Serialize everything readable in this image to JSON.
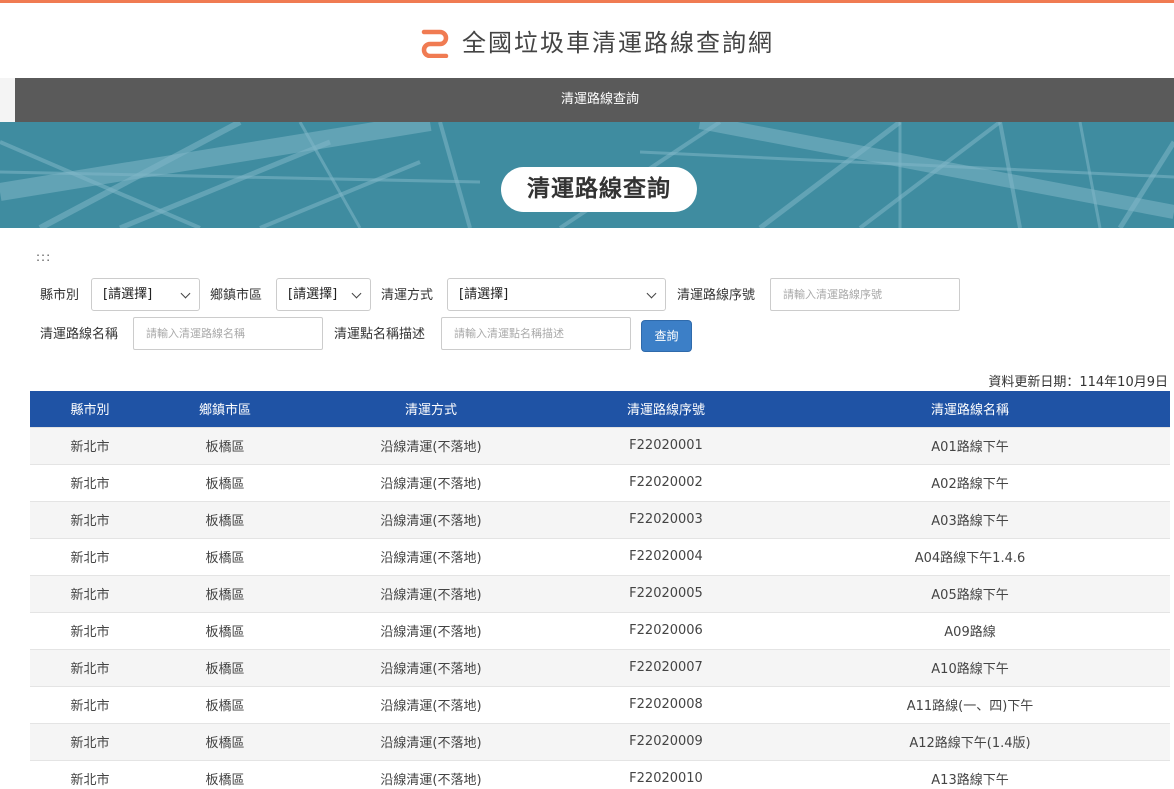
{
  "site": {
    "title": "全國垃圾車清運路線查詢網",
    "accent_color": "#f07b52",
    "logo_icon": "route-logo-icon"
  },
  "nav": {
    "items": [
      {
        "label": "清運路線查詢"
      }
    ]
  },
  "banner": {
    "title": "清運路線查詢"
  },
  "skip_link": ":::",
  "filters": {
    "county": {
      "label": "縣市別",
      "value": "[請選擇]"
    },
    "district": {
      "label": "鄉鎮市區",
      "value": "[請選擇]"
    },
    "method": {
      "label": "清運方式",
      "value": "[請選擇]"
    },
    "route_no": {
      "label": "清運路線序號",
      "placeholder": "請輸入清運路線序號"
    },
    "route_name": {
      "label": "清運路線名稱",
      "placeholder": "請輸入清運路線名稱"
    },
    "point_desc": {
      "label": "清運點名稱描述",
      "placeholder": "請輸入清運點名稱描述"
    },
    "search_label": "查詢"
  },
  "update_date": "資料更新日期：114年10月9日",
  "table": {
    "header_color": "#1f53a5",
    "columns": [
      "縣市別",
      "鄉鎮市區",
      "清運方式",
      "清運路線序號",
      "清運路線名稱"
    ],
    "rows": [
      [
        "新北市",
        "板橋區",
        "沿線清運(不落地)",
        "F22020001",
        "A01路線下午"
      ],
      [
        "新北市",
        "板橋區",
        "沿線清運(不落地)",
        "F22020002",
        "A02路線下午"
      ],
      [
        "新北市",
        "板橋區",
        "沿線清運(不落地)",
        "F22020003",
        "A03路線下午"
      ],
      [
        "新北市",
        "板橋區",
        "沿線清運(不落地)",
        "F22020004",
        "A04路線下午1.4.6"
      ],
      [
        "新北市",
        "板橋區",
        "沿線清運(不落地)",
        "F22020005",
        "A05路線下午"
      ],
      [
        "新北市",
        "板橋區",
        "沿線清運(不落地)",
        "F22020006",
        "A09路線"
      ],
      [
        "新北市",
        "板橋區",
        "沿線清運(不落地)",
        "F22020007",
        "A10路線下午"
      ],
      [
        "新北市",
        "板橋區",
        "沿線清運(不落地)",
        "F22020008",
        "A11路線(一、四)下午"
      ],
      [
        "新北市",
        "板橋區",
        "沿線清運(不落地)",
        "F22020009",
        "A12路線下午(1.4版)"
      ],
      [
        "新北市",
        "板橋區",
        "沿線清運(不落地)",
        "F22020010",
        "A13路線下午"
      ]
    ]
  }
}
